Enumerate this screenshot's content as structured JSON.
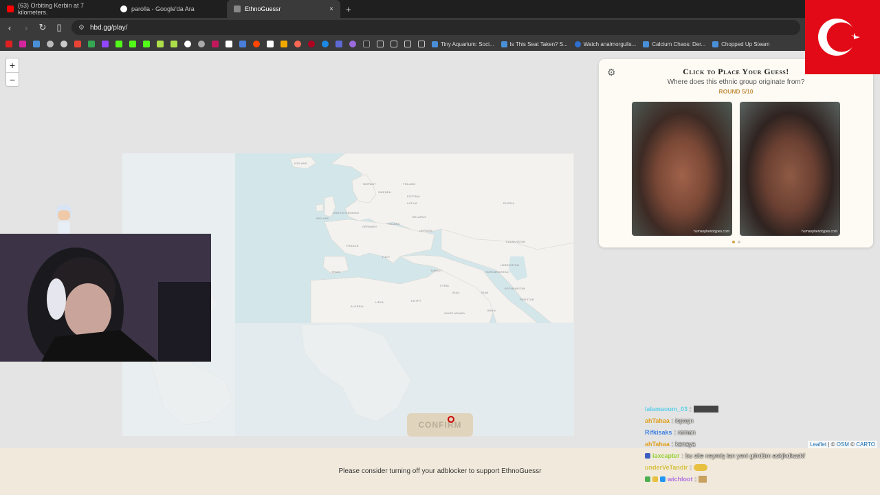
{
  "browser": {
    "tabs": [
      {
        "title": "(63) Orbiting Kerbin at 7 kilometers.",
        "color": "#ff0000",
        "active": false
      },
      {
        "title": "parolla - Google'da Ara",
        "color": "#ffffff",
        "active": false
      },
      {
        "title": "EthnoGuessr",
        "color": "#888888",
        "active": true
      }
    ],
    "tab_close": "×",
    "new_tab": "+",
    "url": "hbd.gg/play/",
    "bookmarks": [
      {
        "label": "Tiny Aquarium: Soci...",
        "color": "#4a90d9"
      },
      {
        "label": "Is This Seat Taken? S...",
        "color": "#4a90d9"
      },
      {
        "label": "Watch analmorgulis...",
        "color": "#2f6fd1"
      },
      {
        "label": "Calcium Chaos: Der...",
        "color": "#4a90d9"
      },
      {
        "label": "Chopped Up Steam",
        "color": "#4a90d9"
      }
    ]
  },
  "map": {
    "zoom_in": "+",
    "zoom_out": "−",
    "labels": [
      {
        "text": "ICELAND"
      },
      {
        "text": "NORWAY"
      },
      {
        "text": "SWEDEN"
      },
      {
        "text": "FINLAND"
      },
      {
        "text": "ESTONIA"
      },
      {
        "text": "LATVIA"
      },
      {
        "text": "BELARUS"
      },
      {
        "text": "UKRAINE"
      },
      {
        "text": "POLAND"
      },
      {
        "text": "GERMANY"
      },
      {
        "text": "FRANCE"
      },
      {
        "text": "SPAIN"
      },
      {
        "text": "ITALY"
      },
      {
        "text": "TURKEY"
      },
      {
        "text": "RUSSIA"
      },
      {
        "text": "KAZAKHSTAN"
      },
      {
        "text": "UZBEKISTAN"
      },
      {
        "text": "TURKMENISTAN"
      },
      {
        "text": "IRAN"
      },
      {
        "text": "IRAQ"
      },
      {
        "text": "SYRIA"
      },
      {
        "text": "AFGHANISTAN"
      },
      {
        "text": "PAKISTAN"
      },
      {
        "text": "SAUDI ARABIA"
      },
      {
        "text": "EGYPT"
      },
      {
        "text": "LIBYA"
      },
      {
        "text": "ALGERIA"
      },
      {
        "text": "OMAN"
      },
      {
        "text": "UNITED KINGDOM"
      },
      {
        "text": "IRELAND"
      }
    ],
    "confirm_label": "CONFIRM",
    "attribution": {
      "leaflet": "Leaflet",
      "sep": " | © ",
      "osm": "OSM",
      "carto": "CARTO"
    }
  },
  "panel": {
    "title": "Click to Place Your Guess!",
    "subtitle": "Where does this ethnic group originate from?",
    "round": "ROUND 5/10",
    "watermarks": [
      "humanphenotypes.com",
      "humanphenotypes.com"
    ]
  },
  "footer": {
    "adblock_text": "Please consider turning off your adblocker to support EthnoGuessr"
  },
  "chat": [
    {
      "user": "lalamaoum_03",
      "sep": ":",
      "msg": "",
      "color": "#5fd0e8"
    },
    {
      "user": "ahTahaa",
      "sep": ":",
      "msg": "ispaçn",
      "color": "#e0a020"
    },
    {
      "user": "Rifkisaks",
      "sep": ":",
      "msg": "roman",
      "color": "#3d7fe0"
    },
    {
      "user": "ahTahaa",
      "sep": ":",
      "msg": "kenaya",
      "color": "#e0a020"
    },
    {
      "user": "laxcapter",
      "sep": ":",
      "msg": "bu site neymiş lan yeni gördüm askjhdkaskf",
      "color": "#9ad040"
    },
    {
      "user": "underVeTandir",
      "sep": ":",
      "msg": "",
      "color": "#d6c040"
    },
    {
      "user": "wichloot",
      "sep": ":",
      "msg": "",
      "color": "#b070e0"
    }
  ]
}
